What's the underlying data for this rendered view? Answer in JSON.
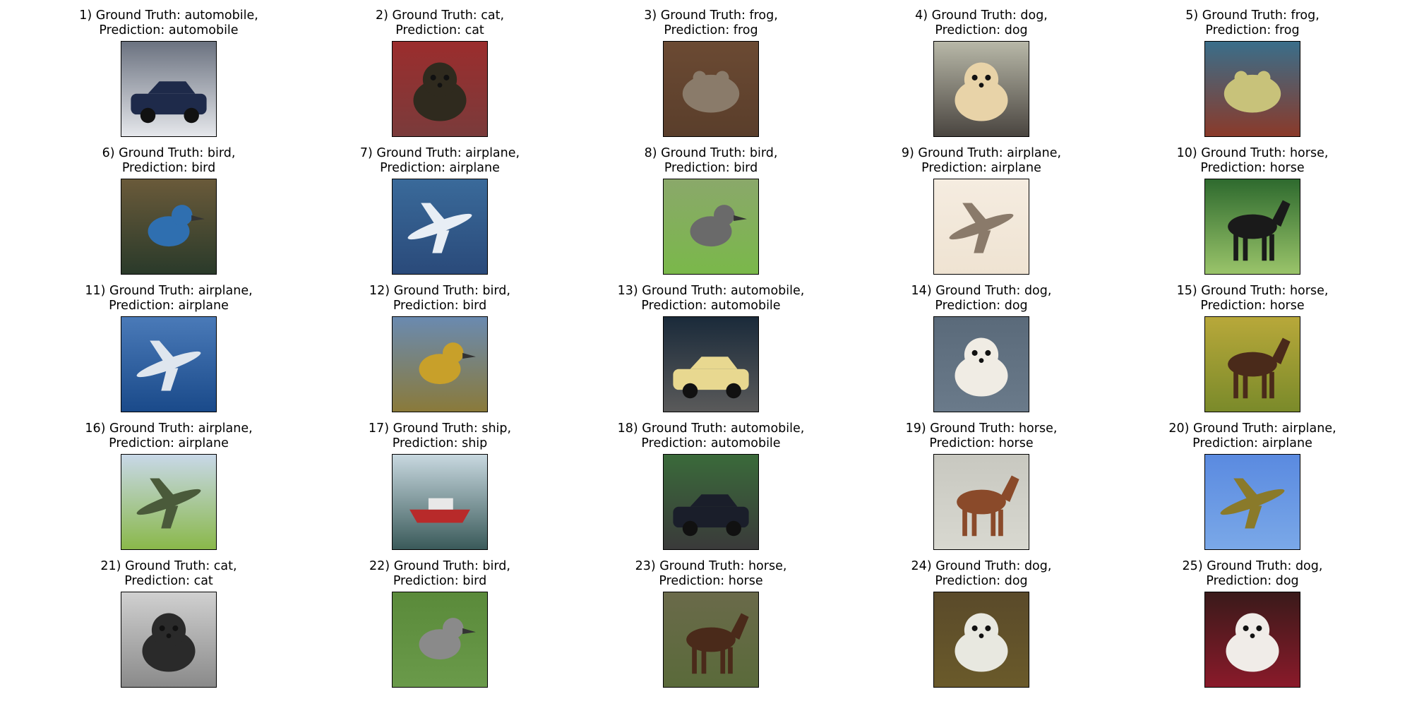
{
  "figure": {
    "images": [
      {
        "index": "1)",
        "ground_truth": "automobile",
        "prediction": "automobile",
        "scene": "car"
      },
      {
        "index": "2)",
        "ground_truth": "cat",
        "prediction": "cat",
        "scene": "cat"
      },
      {
        "index": "3)",
        "ground_truth": "frog",
        "prediction": "frog",
        "scene": "frog"
      },
      {
        "index": "4)",
        "ground_truth": "dog",
        "prediction": "dog",
        "scene": "dog"
      },
      {
        "index": "5)",
        "ground_truth": "frog",
        "prediction": "frog",
        "scene": "frog"
      },
      {
        "index": "6)",
        "ground_truth": "bird",
        "prediction": "bird",
        "scene": "bird"
      },
      {
        "index": "7)",
        "ground_truth": "airplane",
        "prediction": "airplane",
        "scene": "plane"
      },
      {
        "index": "8)",
        "ground_truth": "bird",
        "prediction": "bird",
        "scene": "bird"
      },
      {
        "index": "9)",
        "ground_truth": "airplane",
        "prediction": "airplane",
        "scene": "plane"
      },
      {
        "index": "10)",
        "ground_truth": "horse",
        "prediction": "horse",
        "scene": "horse"
      },
      {
        "index": "11)",
        "ground_truth": "airplane",
        "prediction": "airplane",
        "scene": "plane"
      },
      {
        "index": "12)",
        "ground_truth": "bird",
        "prediction": "bird",
        "scene": "bird"
      },
      {
        "index": "13)",
        "ground_truth": "automobile",
        "prediction": "automobile",
        "scene": "car"
      },
      {
        "index": "14)",
        "ground_truth": "dog",
        "prediction": "dog",
        "scene": "dog"
      },
      {
        "index": "15)",
        "ground_truth": "horse",
        "prediction": "horse",
        "scene": "horse"
      },
      {
        "index": "16)",
        "ground_truth": "airplane",
        "prediction": "airplane",
        "scene": "plane"
      },
      {
        "index": "17)",
        "ground_truth": "ship",
        "prediction": "ship",
        "scene": "ship"
      },
      {
        "index": "18)",
        "ground_truth": "automobile",
        "prediction": "automobile",
        "scene": "car"
      },
      {
        "index": "19)",
        "ground_truth": "horse",
        "prediction": "horse",
        "scene": "horse"
      },
      {
        "index": "20)",
        "ground_truth": "airplane",
        "prediction": "airplane",
        "scene": "plane"
      },
      {
        "index": "21)",
        "ground_truth": "cat",
        "prediction": "cat",
        "scene": "cat"
      },
      {
        "index": "22)",
        "ground_truth": "bird",
        "prediction": "bird",
        "scene": "bird"
      },
      {
        "index": "23)",
        "ground_truth": "horse",
        "prediction": "horse",
        "scene": "horse"
      },
      {
        "index": "24)",
        "ground_truth": "dog",
        "prediction": "dog",
        "scene": "dog"
      },
      {
        "index": "25)",
        "ground_truth": "dog",
        "prediction": "dog",
        "scene": "dog"
      }
    ],
    "thumb_colors": [
      {
        "top": "#6b7280",
        "bottom": "#e5e7eb",
        "subject": "#1e2a4a"
      },
      {
        "top": "#9b2d2d",
        "bottom": "#7a3b3b",
        "subject": "#2f2a1e"
      },
      {
        "top": "#6b4a33",
        "bottom": "#5a3e2b",
        "subject": "#8a7b6a"
      },
      {
        "top": "#b8b8a8",
        "bottom": "#4a4540",
        "subject": "#e8d3a8"
      },
      {
        "top": "#3a6e8a",
        "bottom": "#8a3a2a",
        "subject": "#c8c27a"
      },
      {
        "top": "#6a5a3a",
        "bottom": "#2a3a2a",
        "subject": "#2f6fb0"
      },
      {
        "top": "#3a6a9a",
        "bottom": "#2a4a7a",
        "subject": "#e8eef5"
      },
      {
        "top": "#8aa86a",
        "bottom": "#7ab84a",
        "subject": "#6a6a6a"
      },
      {
        "top": "#f5ece0",
        "bottom": "#efe3d2",
        "subject": "#8a7a6a"
      },
      {
        "top": "#2e6a2e",
        "bottom": "#9ac46a",
        "subject": "#1a1a1a"
      },
      {
        "top": "#4a7ab8",
        "bottom": "#1a4a8a",
        "subject": "#dfe6ee"
      },
      {
        "top": "#6a8ab0",
        "bottom": "#8a7a3a",
        "subject": "#c8a02a"
      },
      {
        "top": "#1a2a3a",
        "bottom": "#5a5a5a",
        "subject": "#e8d890"
      },
      {
        "top": "#5a6a7a",
        "bottom": "#6a7a8a",
        "subject": "#f0ece4"
      },
      {
        "top": "#b8a83a",
        "bottom": "#7a8a2a",
        "subject": "#4a2a1a"
      },
      {
        "top": "#c8d8e8",
        "bottom": "#8ab84a",
        "subject": "#4a5a3a"
      },
      {
        "top": "#c8d8e0",
        "bottom": "#3a5a5a",
        "subject": "#b82a2a"
      },
      {
        "top": "#3a6a3a",
        "bottom": "#3a3a3a",
        "subject": "#1a1e2a"
      },
      {
        "top": "#c8c8c0",
        "bottom": "#d8d8d0",
        "subject": "#8a4a2a"
      },
      {
        "top": "#5a8ae0",
        "bottom": "#7aa8e8",
        "subject": "#8a7a2a"
      },
      {
        "top": "#d0d0d0",
        "bottom": "#8a8a8a",
        "subject": "#2a2a2a"
      },
      {
        "top": "#5a8a3a",
        "bottom": "#6a9a4a",
        "subject": "#8a8a8a"
      },
      {
        "top": "#6a6a4a",
        "bottom": "#5a6a3a",
        "subject": "#4a2a1a"
      },
      {
        "top": "#5a4a2a",
        "bottom": "#6a5a2a",
        "subject": "#e8e8e0"
      },
      {
        "top": "#3a1a1a",
        "bottom": "#8a1a2a",
        "subject": "#f0ece8"
      }
    ]
  }
}
